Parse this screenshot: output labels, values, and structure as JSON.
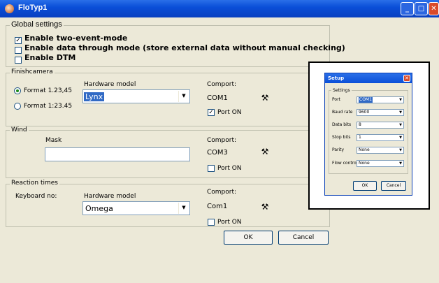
{
  "window": {
    "title": "FloTyp1",
    "min_icon": "minimize-icon",
    "max_icon": "maximize-icon",
    "close_icon": "close-icon"
  },
  "global": {
    "title": "Global settings",
    "opt1": "Enable two-event-mode",
    "opt2": "Enable data through mode (store external data without manual checking)",
    "opt3": "Enable DTM"
  },
  "finish": {
    "title": "Finishcamera",
    "format1": "Format 1.23,45",
    "format2": "Format 1:23.45",
    "hw_label": "Hardware model",
    "hw_value": "Lynx",
    "comport_label": "Comport:",
    "comport_value": "COM1",
    "port_on": "Port ON",
    "port_on_checked": true
  },
  "wind": {
    "title": "Wind",
    "mask_label": "Mask",
    "mask_value": "",
    "comport_label": "Comport:",
    "comport_value": "COM3",
    "port_on": "Port ON"
  },
  "reaction": {
    "title": "Reaction times",
    "keyboard_label": "Keyboard no:",
    "hw_label": "Hardware model",
    "hw_value": "Omega",
    "comport_label": "Comport:",
    "comport_value": "Com1",
    "port_on": "Port ON"
  },
  "buttons": {
    "ok": "OK",
    "cancel": "Cancel"
  },
  "setup": {
    "title": "Setup",
    "group": "Settings",
    "port_label": "Port",
    "port_value": "COM1",
    "baud_label": "Baud rate",
    "baud_value": "9600",
    "databits_label": "Data bits",
    "databits_value": "8",
    "stopbits_label": "Stop bits",
    "stopbits_value": "1",
    "parity_label": "Parity",
    "parity_value": "None",
    "flow_label": "Flow control",
    "flow_value": "None",
    "ok": "OK",
    "cancel": "Cancel"
  }
}
